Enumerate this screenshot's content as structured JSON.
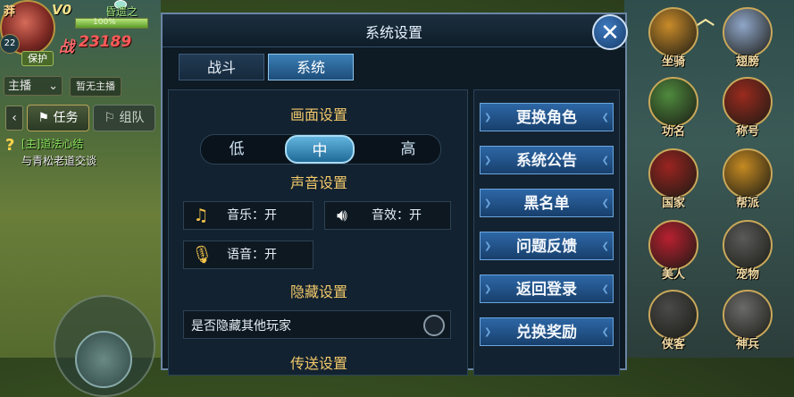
{
  "hud": {
    "player_name": "莽",
    "vip": "V0",
    "gem_status": "昏遗之",
    "hp_percent_text": "100%",
    "hp_fraction": 1.0,
    "power_prefix": "战",
    "power": "23189",
    "level": "22",
    "protect_label": "保护",
    "anchor_dropdown": "主播",
    "no_anchor_label": "暂无主播",
    "quest_tab": "任务",
    "team_tab": "组队",
    "quest_title": "[主]道法心结",
    "quest_desc": "与青松老道交谈"
  },
  "side_icons": [
    {
      "name": "mount-icon",
      "label": "坐骑",
      "color": "#c98b2a"
    },
    {
      "name": "wings-icon",
      "label": "翅膀",
      "color": "#8fa6c8"
    },
    {
      "name": "merit-icon",
      "label": "功名",
      "color": "#4f8a3e"
    },
    {
      "name": "title-icon",
      "label": "称号",
      "color": "#9a2a1e"
    },
    {
      "name": "nation-icon",
      "label": "国家",
      "color": "#9a2420"
    },
    {
      "name": "faction-icon",
      "label": "帮派",
      "color": "#c58a22"
    },
    {
      "name": "beauty-icon",
      "label": "美人",
      "color": "#b82030"
    },
    {
      "name": "pet-icon",
      "label": "宠物",
      "color": "#5a5a5a"
    },
    {
      "name": "knight-icon",
      "label": "侠客",
      "color": "#4a4a4a"
    },
    {
      "name": "weapon-icon",
      "label": "神兵",
      "color": "#6a6a6a"
    }
  ],
  "dialog": {
    "title": "系统设置",
    "tabs": [
      "战斗",
      "系统"
    ],
    "active_tab": "系统",
    "graphics_title": "画面设置",
    "quality_options": [
      "低",
      "中",
      "高"
    ],
    "quality_selected": "中",
    "sound_title": "声音设置",
    "music_label": "音乐：开",
    "sfx_label": "音效：开",
    "voice_label": "语音：开",
    "hide_title": "隐藏设置",
    "hide_players_label": "是否隐藏其他玩家",
    "more_title": "传送设置",
    "menu": [
      "更换角色",
      "系统公告",
      "黑名单",
      "问题反馈",
      "返回登录",
      "兑换奖励"
    ]
  }
}
